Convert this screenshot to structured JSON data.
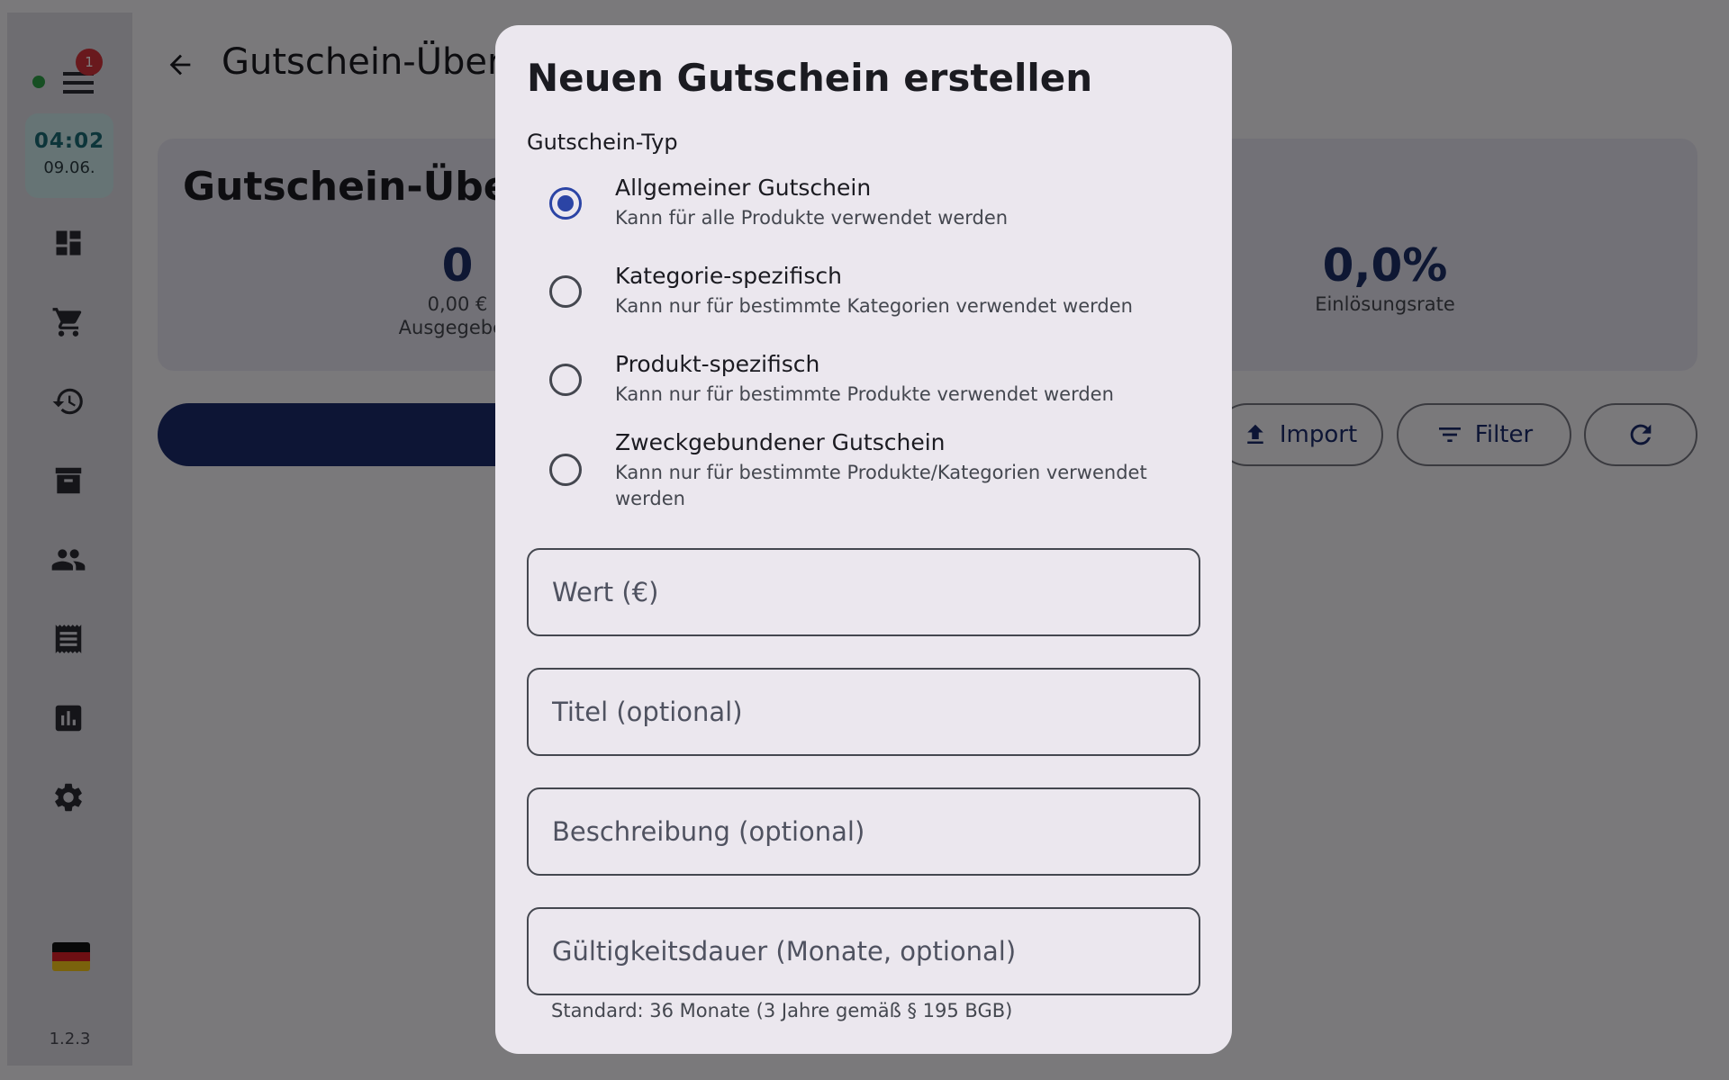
{
  "sidebar": {
    "notification_count": "1",
    "clock": {
      "time": "04:02",
      "date": "09.06."
    },
    "nav_items": [
      "dashboard-icon",
      "cart-icon",
      "history-icon",
      "archive-icon",
      "people-icon",
      "receipt-icon",
      "chart-icon",
      "gear-icon"
    ],
    "language_flag": "de",
    "version": "1.2.3"
  },
  "header": {
    "title": "Gutschein-Übersicht"
  },
  "stats": {
    "title": "Gutschein-Übersicht",
    "issued": {
      "value": "0",
      "amount": "0,00 €",
      "label": "Ausgegeben"
    },
    "redemption": {
      "value": "0,0%",
      "label": "Einlösungsrate"
    }
  },
  "actions": {
    "import_label": "Import",
    "filter_label": "Filter"
  },
  "dialog": {
    "title": "Neuen Gutschein erstellen",
    "type_label": "Gutschein-Typ",
    "options": [
      {
        "label": "Allgemeiner Gutschein",
        "description": "Kann für alle Produkte verwendet werden",
        "selected": true
      },
      {
        "label": "Kategorie-spezifisch",
        "description": "Kann nur für bestimmte Kategorien verwendet werden",
        "selected": false
      },
      {
        "label": "Produkt-spezifisch",
        "description": "Kann nur für bestimmte Produkte verwendet werden",
        "selected": false
      },
      {
        "label": "Zweckgebundener Gutschein",
        "description": "Kann nur für bestimmte Produkte/Kategorien verwendet werden",
        "selected": false
      }
    ],
    "fields": {
      "value_placeholder": "Wert (€)",
      "title_placeholder": "Titel (optional)",
      "description_placeholder": "Beschreibung (optional)",
      "validity_placeholder": "Gültigkeitsdauer (Monate, optional)"
    },
    "validity_helper": "Standard: 36 Monate (3 Jahre gemäß § 195 BGB)"
  },
  "colors": {
    "primary": "#1b2a6b",
    "radio_selected": "#2b44a5",
    "badge": "#d2333a",
    "clock_bg": "#cde8ea",
    "status_online": "#2e9e46"
  }
}
